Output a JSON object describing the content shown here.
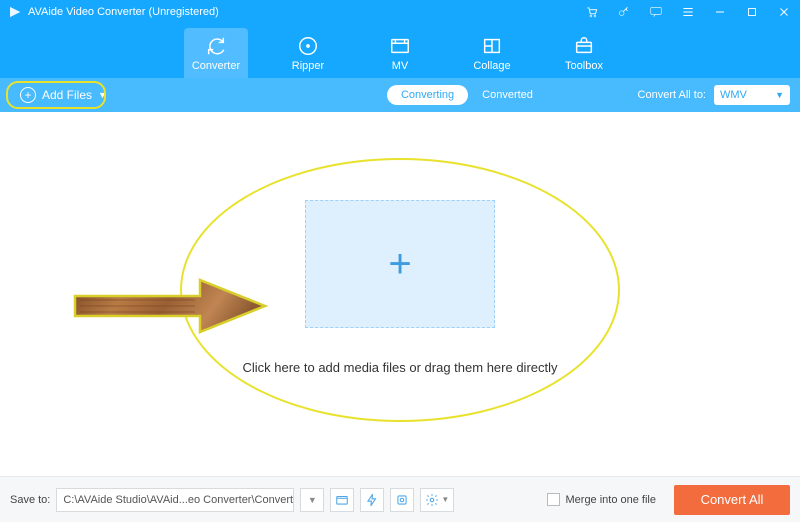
{
  "titlebar": {
    "app_name": "AVAide Video Converter (Unregistered)"
  },
  "nav": {
    "items": [
      {
        "label": "Converter",
        "icon": "convert-icon",
        "active": true
      },
      {
        "label": "Ripper",
        "icon": "ripper-icon"
      },
      {
        "label": "MV",
        "icon": "mv-icon"
      },
      {
        "label": "Collage",
        "icon": "collage-icon"
      },
      {
        "label": "Toolbox",
        "icon": "toolbox-icon"
      }
    ]
  },
  "subbar": {
    "add_files_label": "Add Files",
    "tabs": {
      "converting": "Converting",
      "converted": "Converted"
    },
    "convert_all_label": "Convert All to:",
    "format_selected": "WMV"
  },
  "main": {
    "drop_text": "Click here to add media files or drag them here directly"
  },
  "bottombar": {
    "save_to_label": "Save to:",
    "save_path": "C:\\AVAide Studio\\AVAid...eo Converter\\Converted",
    "merge_label": "Merge into one file",
    "convert_all_button": "Convert All"
  }
}
